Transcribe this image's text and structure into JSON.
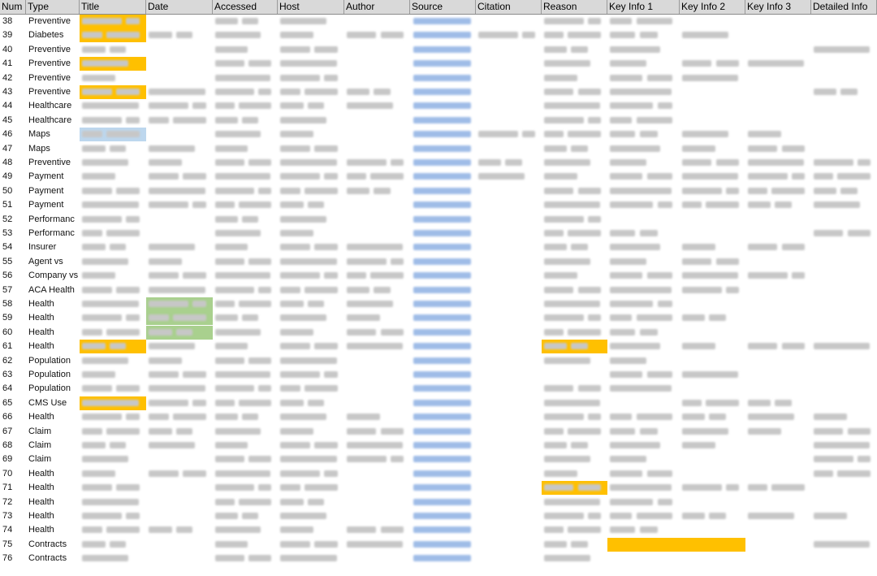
{
  "columns": [
    "Num",
    "Type",
    "Title",
    "Date",
    "Accessed",
    "Host",
    "Author",
    "Source",
    "Citation",
    "Reason",
    "Key Info 1",
    "Key Info 2",
    "Key Info 3",
    "Detailed Info"
  ],
  "rows": [
    {
      "num": "38",
      "type": "Preventive"
    },
    {
      "num": "39",
      "type": "Diabetes"
    },
    {
      "num": "40",
      "type": "Preventive"
    },
    {
      "num": "41",
      "type": "Preventive"
    },
    {
      "num": "42",
      "type": "Preventive"
    },
    {
      "num": "43",
      "type": "Preventive"
    },
    {
      "num": "44",
      "type": "Healthcare"
    },
    {
      "num": "45",
      "type": "Healthcare"
    },
    {
      "num": "46",
      "type": "Maps"
    },
    {
      "num": "47",
      "type": "Maps"
    },
    {
      "num": "48",
      "type": "Preventive"
    },
    {
      "num": "49",
      "type": "Payment"
    },
    {
      "num": "50",
      "type": "Payment"
    },
    {
      "num": "51",
      "type": "Payment"
    },
    {
      "num": "52",
      "type": "Performanc"
    },
    {
      "num": "53",
      "type": "Performanc"
    },
    {
      "num": "54",
      "type": "Insurer"
    },
    {
      "num": "55",
      "type": "Agent     vs"
    },
    {
      "num": "56",
      "type": "Company  vs"
    },
    {
      "num": "57",
      "type": "ACA  Health"
    },
    {
      "num": "58",
      "type": "Health"
    },
    {
      "num": "59",
      "type": "Health"
    },
    {
      "num": "60",
      "type": "Health"
    },
    {
      "num": "61",
      "type": "Health"
    },
    {
      "num": "62",
      "type": "Population"
    },
    {
      "num": "63",
      "type": "Population"
    },
    {
      "num": "64",
      "type": "Population"
    },
    {
      "num": "65",
      "type": "CMS Use"
    },
    {
      "num": "66",
      "type": "Health"
    },
    {
      "num": "67",
      "type": "Claim"
    },
    {
      "num": "68",
      "type": "Claim"
    },
    {
      "num": "69",
      "type": "Claim"
    },
    {
      "num": "70",
      "type": "Health"
    },
    {
      "num": "71",
      "type": "Health"
    },
    {
      "num": "72",
      "type": "Health"
    },
    {
      "num": "73",
      "type": "Health"
    },
    {
      "num": "74",
      "type": "Health"
    },
    {
      "num": "75",
      "type": "Contracts"
    },
    {
      "num": "76",
      "type": "Contracts"
    }
  ],
  "colors": {
    "header_bg": "#d9d9d9",
    "highlight_orange": "#ffc000",
    "highlight_blue": "#bdd7ee",
    "highlight_green": "#a9d08e",
    "link_text": "#8fb1e3",
    "redacted_text": "#c7c7c7"
  }
}
